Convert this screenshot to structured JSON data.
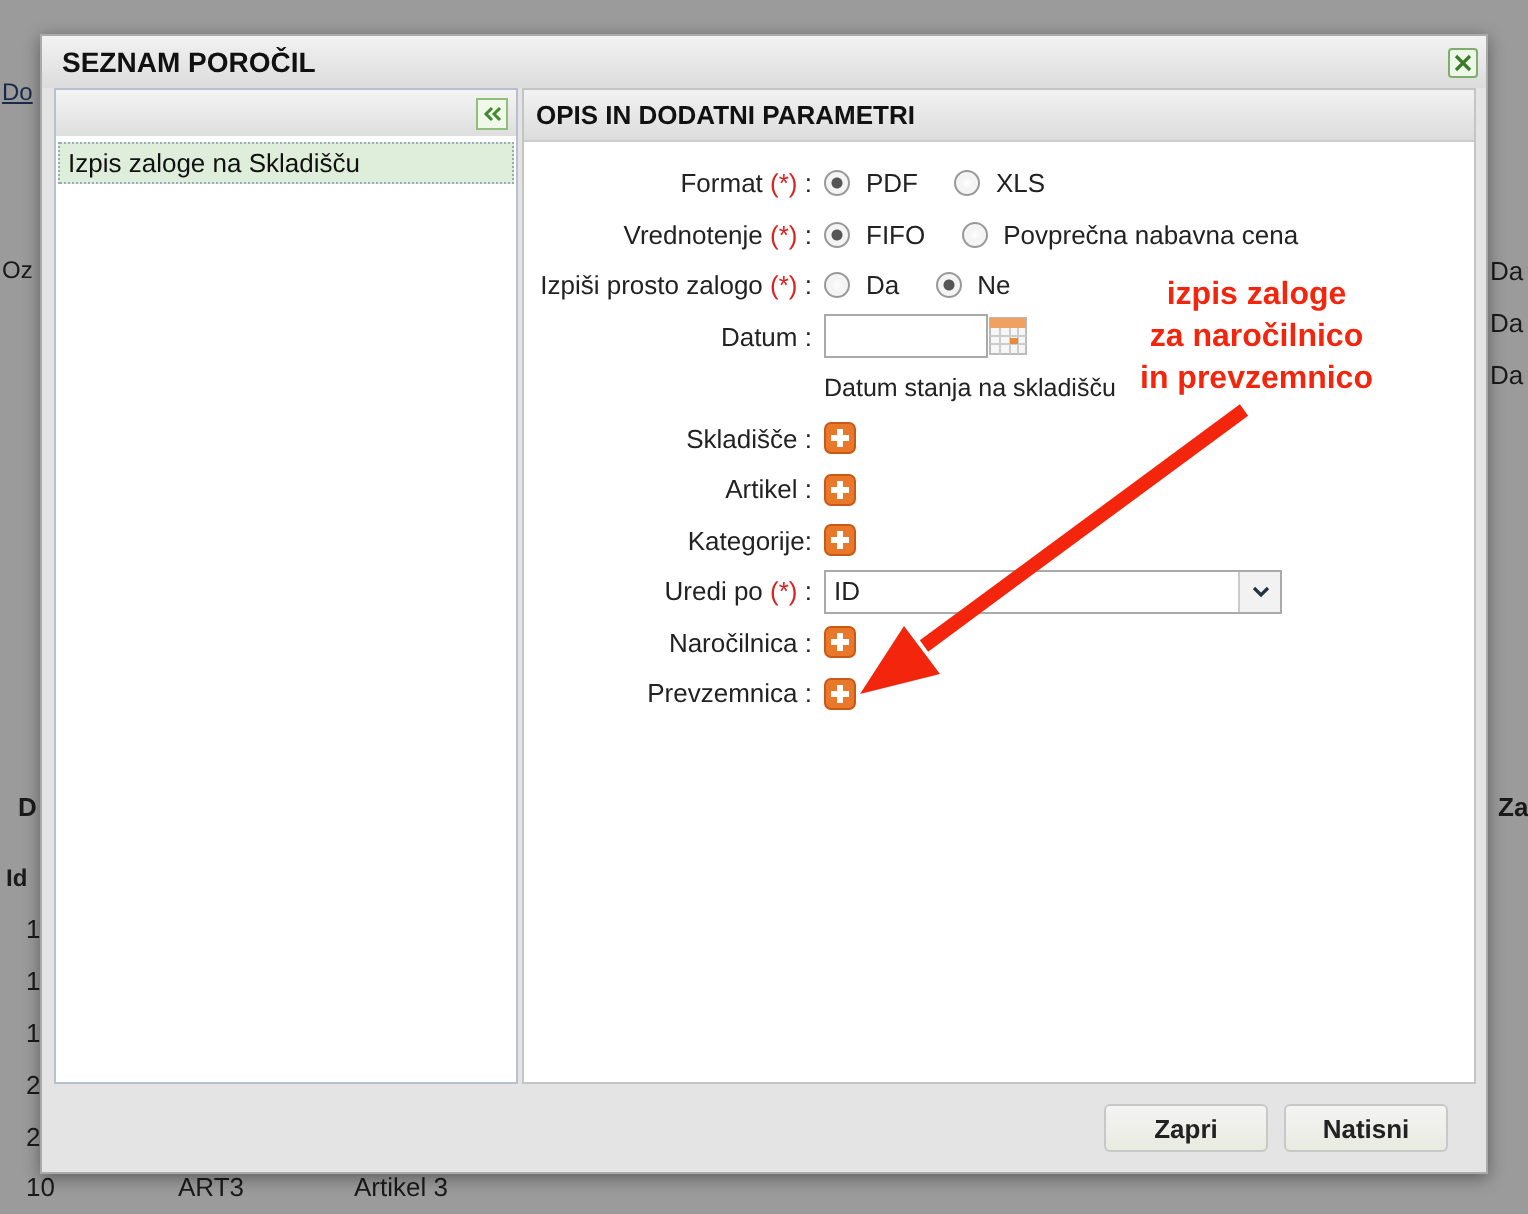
{
  "background": {
    "link": "Do",
    "label": "Oz",
    "values": [
      "Da",
      "Da",
      "Da"
    ],
    "header_left": "D",
    "header_right": "Za",
    "id_header": "Id",
    "row_ids": [
      "1",
      "1",
      "1",
      "2",
      "2"
    ],
    "last_row": {
      "id": "10",
      "code": "ART3",
      "name": "Artikel 3"
    }
  },
  "dialog": {
    "title": "SEZNAM POROČIL",
    "reports": [
      {
        "label": "Izpis zaloge na Skladišču",
        "selected": true
      }
    ],
    "panel_title": "OPIS IN DODATNI PARAMETRI",
    "fields": [
      {
        "kind": "radio",
        "label": "Format",
        "required": "(*)",
        "separator": ":",
        "options": [
          {
            "label": "PDF",
            "selected": true
          },
          {
            "label": "XLS",
            "selected": false
          }
        ]
      },
      {
        "kind": "radio",
        "label": "Vrednotenje",
        "required": "(*)",
        "separator": ":",
        "options": [
          {
            "label": "FIFO",
            "selected": true
          },
          {
            "label": "Povprečna nabavna cena",
            "selected": false
          }
        ]
      },
      {
        "kind": "radio",
        "label": "Izpiši prosto zalogo",
        "required": "(*)",
        "separator": ":",
        "options": [
          {
            "label": "Da",
            "selected": false
          },
          {
            "label": "Ne",
            "selected": true
          }
        ]
      },
      {
        "kind": "date",
        "label": "Datum",
        "separator": ":",
        "helper": "Datum stanja na skladišču"
      },
      {
        "kind": "add",
        "label": "Skladišče",
        "separator": ":"
      },
      {
        "kind": "add",
        "label": "Artikel",
        "separator": ":"
      },
      {
        "kind": "add",
        "label": "Kategorije:"
      },
      {
        "kind": "select",
        "label": "Uredi po",
        "required": "(*)",
        "separator": ":",
        "value": "ID"
      },
      {
        "kind": "add",
        "label": "Naročilnica",
        "separator": ":"
      },
      {
        "kind": "add",
        "label": "Prevzemnica",
        "separator": ":"
      }
    ],
    "buttons": [
      "Zapri",
      "Natisni"
    ]
  },
  "annotation": {
    "lines": [
      "izpis zaloge",
      "za naročilnico",
      "in prevzemnico"
    ]
  }
}
